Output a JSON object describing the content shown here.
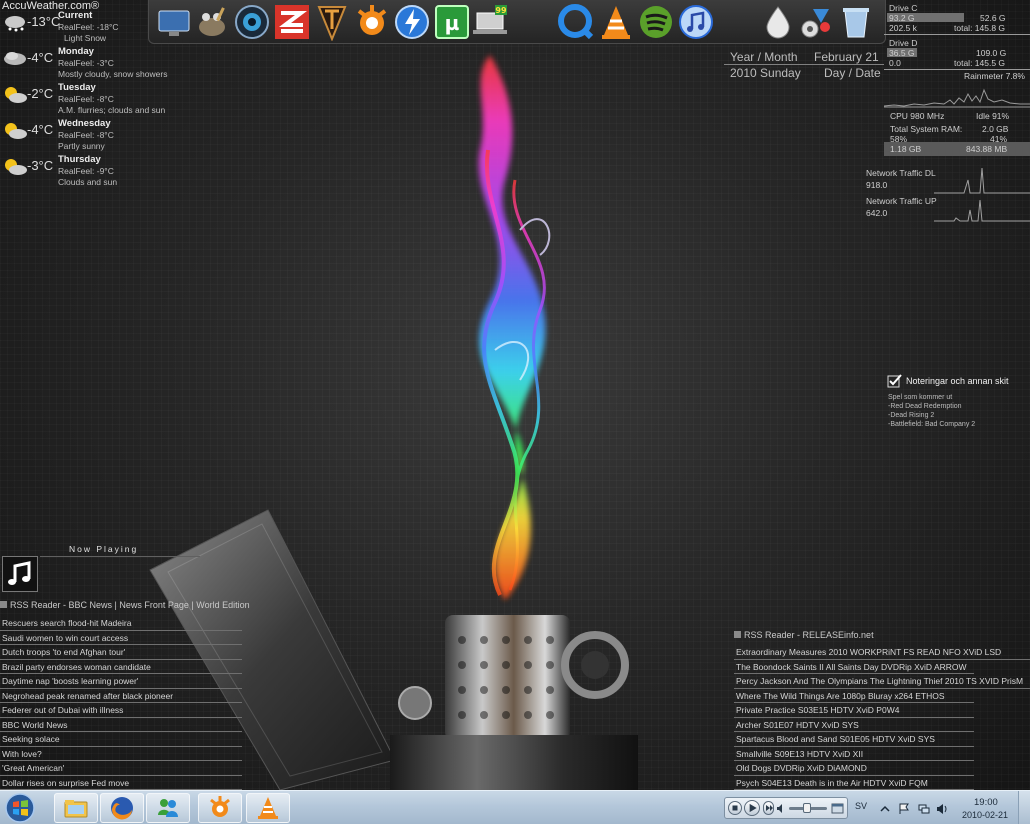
{
  "weather": {
    "brand": "AccuWeather.com®",
    "days": [
      {
        "temp": "-13°C",
        "name": "Current",
        "realfeel": "RealFeel: -18°C",
        "desc": "Light Snow",
        "icon": "snow-cloud-icon"
      },
      {
        "temp": "-4°C",
        "name": "Monday",
        "realfeel": "RealFeel: -3°C",
        "desc": "Mostly cloudy, snow showers",
        "icon": "cloud-icon"
      },
      {
        "temp": "-2°C",
        "name": "Tuesday",
        "realfeel": "RealFeel: -8°C",
        "desc": "A.M. flurries; clouds and sun",
        "icon": "sun-cloud-icon"
      },
      {
        "temp": "-4°C",
        "name": "Wednesday",
        "realfeel": "RealFeel: -8°C",
        "desc": "Partly sunny",
        "icon": "sun-cloud-icon"
      },
      {
        "temp": "-3°C",
        "name": "Thursday",
        "realfeel": "RealFeel: -9°C",
        "desc": "Clouds and sun",
        "icon": "sun-cloud-icon"
      }
    ]
  },
  "dock": {
    "items": [
      {
        "name": "my-computer-icon"
      },
      {
        "name": "gimp-icon"
      },
      {
        "name": "webcam-icon"
      },
      {
        "name": "zune-icon"
      },
      {
        "name": "warhammer-icon"
      },
      {
        "name": "avast-icon"
      },
      {
        "name": "thunder-icon"
      },
      {
        "name": "utorrent-icon"
      },
      {
        "name": "notebook-icon"
      },
      {
        "name": "quicktime-icon"
      },
      {
        "name": "vlc-icon"
      },
      {
        "name": "spotify-icon"
      },
      {
        "name": "itunes-icon"
      },
      {
        "name": "water-drop-icon"
      },
      {
        "name": "control-panel-icon"
      },
      {
        "name": "recycle-bin-icon"
      }
    ],
    "badge": "99"
  },
  "date": {
    "year_month_label": "Year / Month",
    "month_day": "February 21",
    "year_weekday": "2010 Sunday",
    "day_date_label": "Day / Date"
  },
  "system": {
    "drive_c": {
      "label": "Drive C",
      "used": "93.2 G",
      "free": "52.6 G",
      "sub": "202.5 k",
      "total": "total: 145.8 G",
      "fill": 0.64
    },
    "drive_d": {
      "label": "Drive D",
      "used": "36.5 G",
      "free": "109.0 G",
      "sub": "0.0",
      "total": "total: 145.5 G",
      "fill": 0.25
    },
    "rainmeter": "Rainmeter 7.8%",
    "cpu": "CPU 980 MHz",
    "idle": "Idle 91%",
    "ram_label": "Total System RAM:",
    "ram_total": "2.0 GB",
    "ram_used_pct": "58%",
    "ram_free_pct": "41%",
    "ram_used": "1.18 GB",
    "ram_free": "843.88 MB"
  },
  "network": {
    "dl_label": "Network Traffic DL",
    "dl_value": "918.0",
    "up_label": "Network Traffic UP",
    "up_value": "642.0"
  },
  "notes": {
    "title": "Noteringar och annan skit",
    "lines": [
      "Spel som kommer ut",
      "-Red Dead Redemption",
      "-Dead Rising 2",
      "-Battlefield: Bad Company 2"
    ]
  },
  "nowplaying": {
    "label": "Now Playing"
  },
  "rss_bbc": {
    "header": "RSS Reader - BBC News | News Front Page | World Edition",
    "items": [
      "Rescuers search flood-hit Madeira",
      "Saudi women to win court access",
      "Dutch troops 'to end Afghan tour'",
      "Brazil party endorses woman candidate",
      "Daytime nap 'boosts learning power'",
      "Negrohead peak renamed after black pioneer",
      "Federer out of Dubai with illness",
      "BBC World News",
      "Seeking solace",
      "With love?",
      "'Great American'",
      "Dollar rises on surprise Fed move"
    ]
  },
  "rss_release": {
    "header": "RSS Reader - RELEASEinfo.net",
    "items": [
      "Extraordinary Measures 2010 WORKPRiNT FS READ NFO XViD LSD",
      "The Boondock Saints II All Saints Day DVDRip XviD ARROW",
      "Percy Jackson And The Olympians The Lightning Thief 2010 TS XVID PrisM",
      "Where The Wild Things Are 1080p Bluray x264 ETHOS",
      "Private Practice S03E15 HDTV XviD P0W4",
      "Archer S01E07 HDTV XviD SYS",
      "Spartacus Blood and Sand S01E05 HDTV XviD SYS",
      "Smallville S09E13 HDTV XviD XII",
      "Old Dogs DVDRip XviD DiAMOND",
      "Psych S04E13 Death is in the Air HDTV XviD FQM"
    ]
  },
  "taskbar": {
    "pinned": [
      {
        "name": "explorer-folder-icon"
      },
      {
        "name": "firefox-icon"
      },
      {
        "name": "messenger-icon"
      },
      {
        "name": "avast-taskbar-icon"
      },
      {
        "name": "vlc-taskbar-icon"
      }
    ],
    "language": "SV",
    "time": "19:00",
    "date": "2010-02-21"
  }
}
